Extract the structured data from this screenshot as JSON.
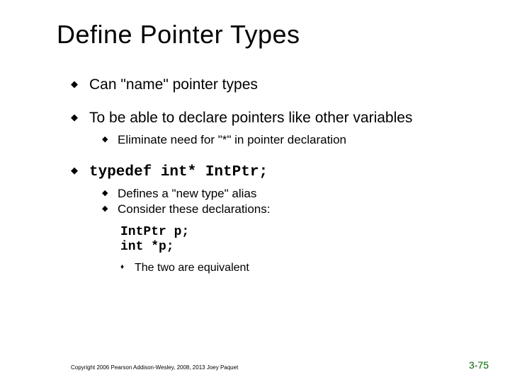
{
  "title": "Define Pointer Types",
  "bullets": {
    "b1": "Can \"name\" pointer types",
    "b2": "To be able to declare pointers like other variables",
    "b2a": "Eliminate need for \"*\" in pointer declaration",
    "b3_code": "typedef int* IntPtr;",
    "b3a": "Defines a \"new type\" alias",
    "b3b": "Consider these declarations:",
    "code_line1": "IntPtr p;",
    "code_line2": "int *p;",
    "b3c": "The two are equivalent"
  },
  "footer": {
    "copyright": "Copyright 2006 Pearson Addison-Wesley, 2008, 2013 Joey Paquet",
    "page": "3-75"
  }
}
